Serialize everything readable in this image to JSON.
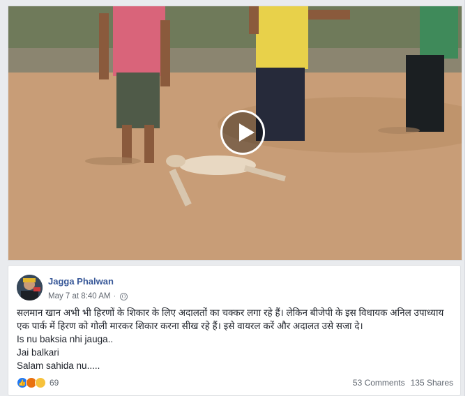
{
  "video": {
    "play_icon": "play-icon"
  },
  "post": {
    "author": "Jagga Phalwan",
    "timestamp": "May 7 at 8:40 AM",
    "privacy_icon": "globe-icon",
    "lines": [
      "सलमान खान अभी भी हिरणों के शिकार के लिए अदालतों का चक्कर लगा रहे हैं। लेकिन बीजेपी के इस विधायक अनिल उपाध्याय एक पार्क में हिरण को गोली मारकर शिकार करना सीख रहे हैं। इसे वायरल करें और अदालत उसे सजा दे।",
      "Is nu baksia nhi jauga..",
      "Jai balkari",
      "Salam sahida nu....."
    ],
    "reactions": {
      "icons": [
        "like-icon",
        "angry-icon",
        "sad-icon"
      ],
      "count": "69"
    },
    "comments": "53 Comments",
    "shares": "135 Shares"
  },
  "colors": {
    "author_link": "#385898",
    "like": "#2078f4",
    "angry": "#e9710f",
    "sad": "#f7c23c"
  }
}
